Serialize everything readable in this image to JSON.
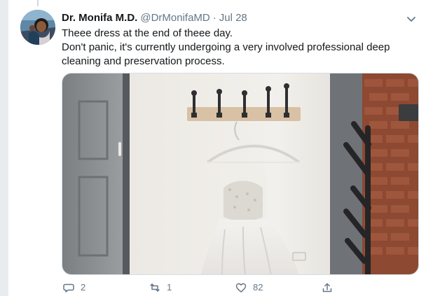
{
  "tweet": {
    "author": {
      "display_name": "Dr. Monifa M.D.",
      "handle": "@DrMonifaMD",
      "separator": "·",
      "timestamp": "Jul 28"
    },
    "text_lines": [
      "Theee dress at the end of theee day.",
      "Don't panic, it's currently undergoing a very involved professional deep",
      "cleaning and preservation process."
    ],
    "actions": {
      "reply_count": "2",
      "retweet_count": "1",
      "like_count": "82"
    },
    "icons": {
      "reply": "reply-icon",
      "retweet": "retweet-icon",
      "like": "heart-icon",
      "share": "share-icon",
      "menu": "chevron-down-icon"
    },
    "colors": {
      "text": "#14171a",
      "muted": "#657786",
      "border": "#d7dde2"
    }
  }
}
